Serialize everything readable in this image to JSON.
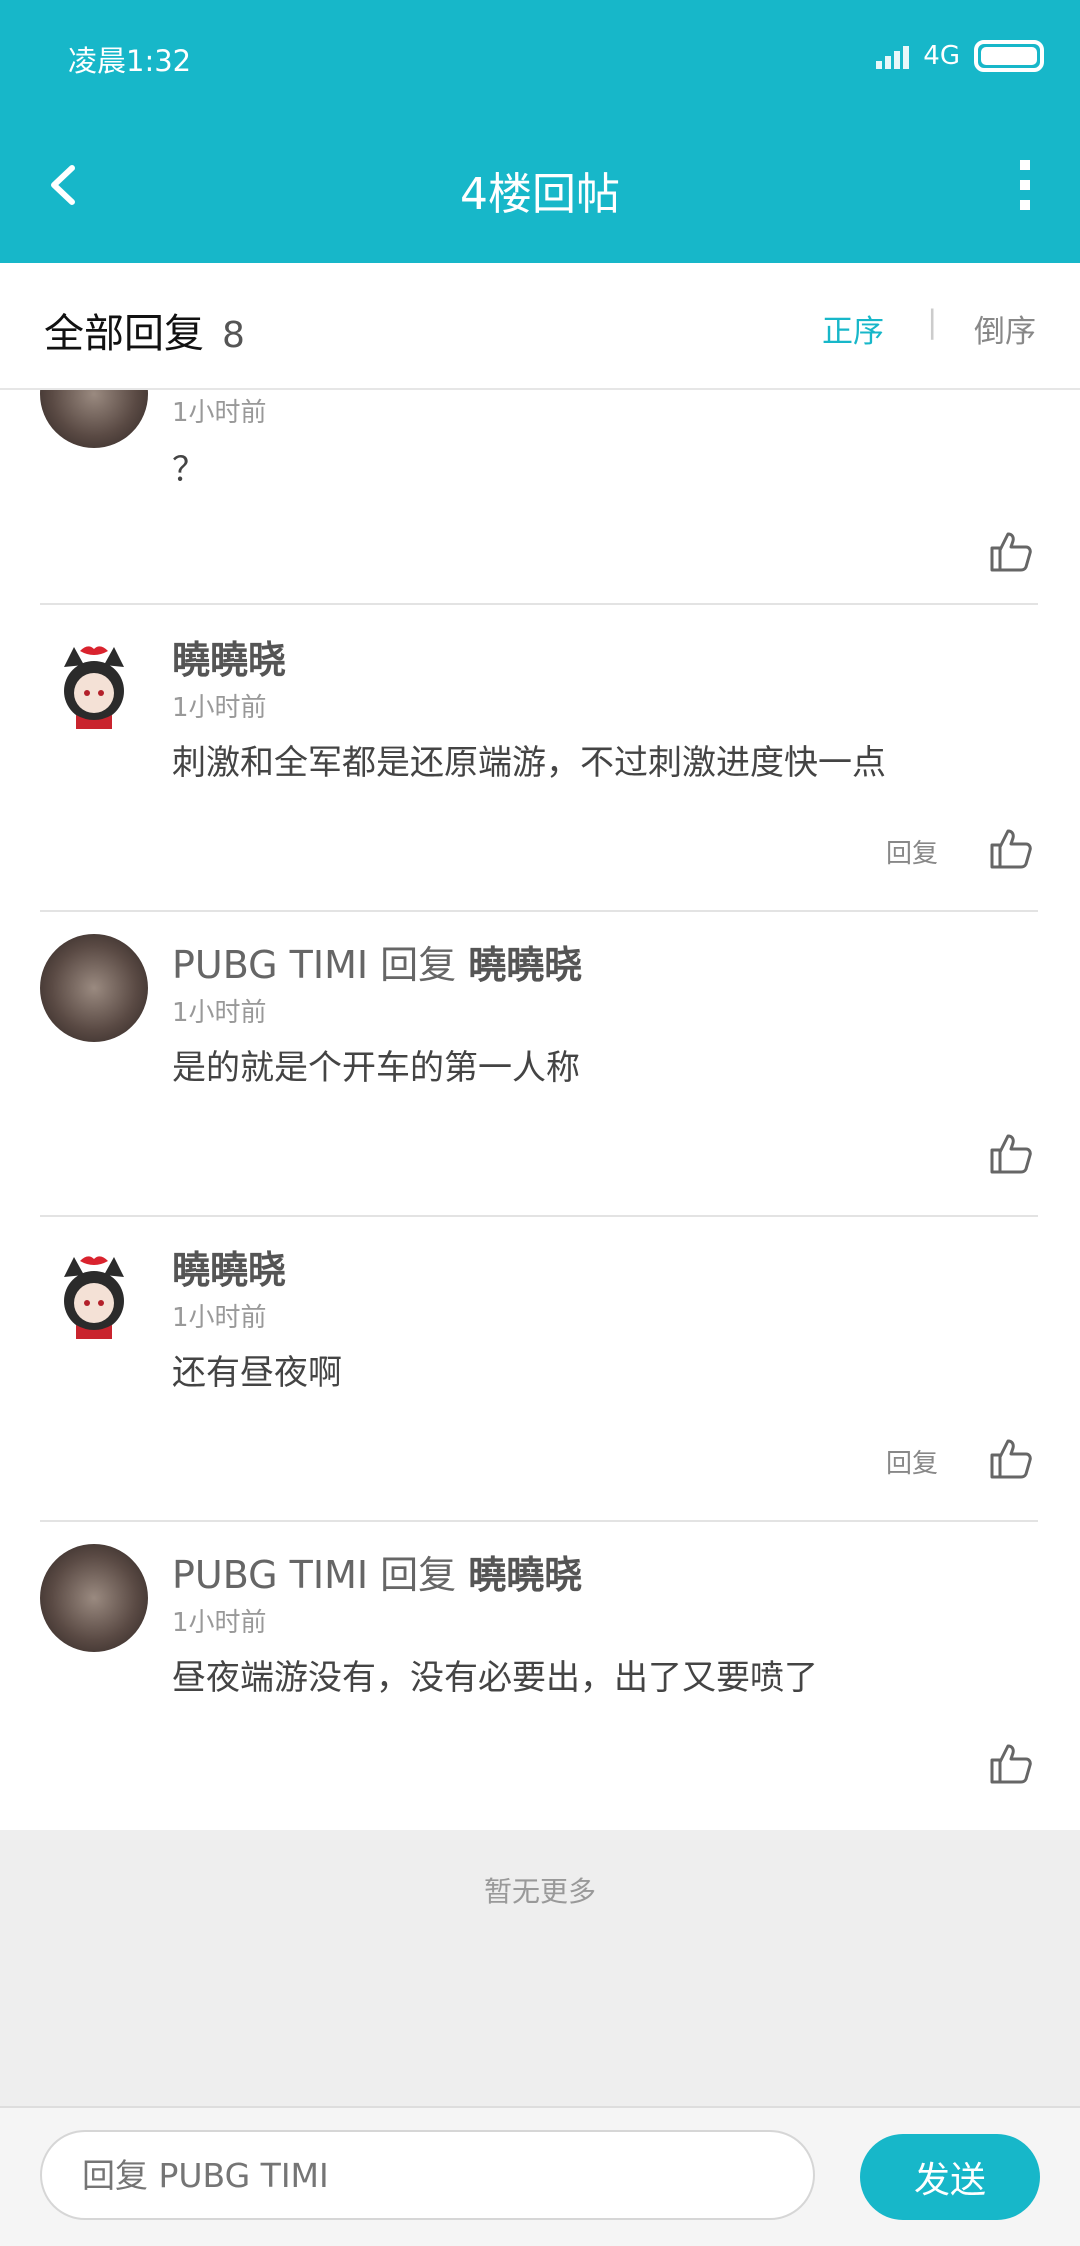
{
  "status": {
    "time": "凌晨1:32",
    "network": "4G"
  },
  "nav": {
    "title": "4楼回帖"
  },
  "header": {
    "label": "全部回复",
    "count": "8",
    "sort_asc": "正序",
    "sort_sep": "|",
    "sort_desc": "倒序"
  },
  "replies": [
    {
      "user": "",
      "reply_to": "",
      "time": "1小时前",
      "content": "？",
      "has_reply_action": false
    },
    {
      "user": "曉曉晓",
      "reply_to": "",
      "time": "1小时前",
      "content": "刺激和全军都是还原端游，不过刺激进度快一点",
      "has_reply_action": true
    },
    {
      "user": "PUBG TIMI",
      "reply_word": "回复",
      "reply_to": "曉曉晓",
      "time": "1小时前",
      "content": "是的就是个开车的第一人称",
      "has_reply_action": false
    },
    {
      "user": "曉曉晓",
      "reply_to": "",
      "time": "1小时前",
      "content": "还有昼夜啊",
      "has_reply_action": true
    },
    {
      "user": "PUBG TIMI",
      "reply_word": "回复",
      "reply_to": "曉曉晓",
      "time": "1小时前",
      "content": "昼夜端游没有，没有必要出，出了又要喷了",
      "has_reply_action": false
    }
  ],
  "reply_action_label": "回复",
  "footer": {
    "no_more": "暂无更多"
  },
  "composer": {
    "placeholder": "回复 PUBG TIMI",
    "send_label": "发送"
  },
  "colors": {
    "accent": "#17b7c9"
  }
}
